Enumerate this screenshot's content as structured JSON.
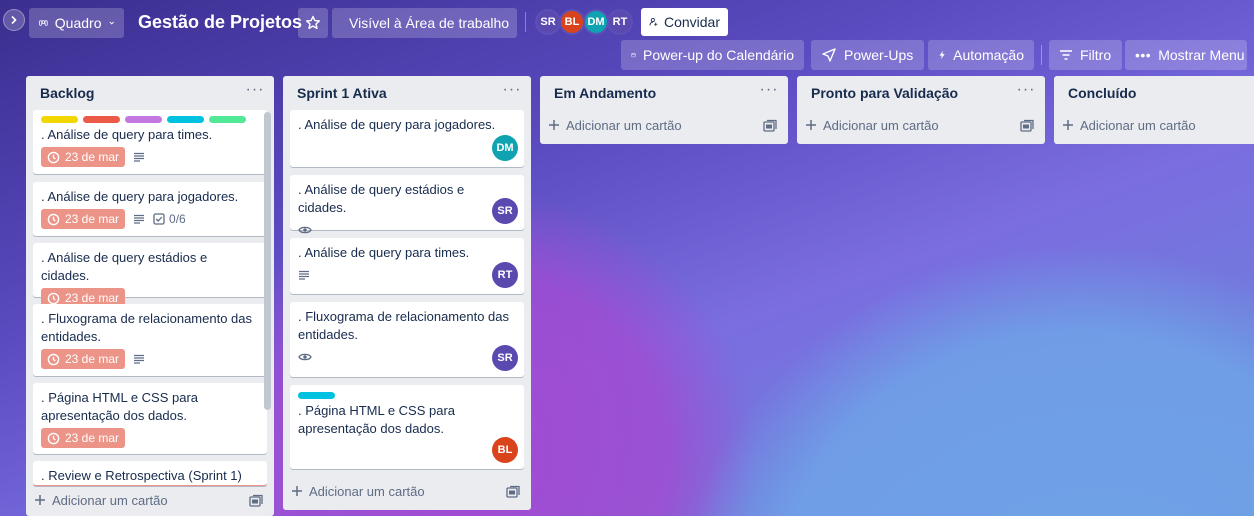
{
  "colors": {
    "due_badge": "#ec9488",
    "label_yellow": "#f2d600",
    "label_red": "#eb5a46",
    "label_purple": "#c377e0",
    "label_sky": "#00c2e0",
    "label_lime": "#51e898",
    "avatar_sr": "#5a4ab0",
    "avatar_bl": "#d9441c",
    "avatar_dm": "#0fa3b1",
    "avatar_rt": "#5a4ab0"
  },
  "header": {
    "view_label": "Quadro",
    "board_title": "Gestão de Projetos",
    "visibility_label": "Visível à Área de trabalho",
    "members": [
      "SR",
      "BL",
      "DM",
      "RT"
    ],
    "invite_label": "Convidar",
    "calendar_label": "Power-up do Calendário",
    "powerups_label": "Power-Ups",
    "automation_label": "Automação",
    "filter_label": "Filtro",
    "menu_label": "Mostrar Menu"
  },
  "lists": [
    {
      "title": "Backlog",
      "add_label": "Adicionar um cartão",
      "cards": [
        {
          "title": ". Análise de query para times.",
          "due": "23 de mar",
          "labels": [
            "label-yellow",
            "label-red",
            "label-purple",
            "label-sky",
            "label-lime"
          ]
        },
        {
          "title": ". Análise de query para jogadores.",
          "due": "23 de mar",
          "checklist": "0/6"
        },
        {
          "title": ". Análise de query estádios e cidades.",
          "due": "23 de mar"
        },
        {
          "title": ". Fluxograma de relacionamento das entidades.",
          "due": "23 de mar"
        },
        {
          "title": ". Página HTML e CSS para apresentação dos dados.",
          "due": "23 de mar"
        },
        {
          "title": ". Review e Retrospectiva (Sprint 1)"
        }
      ]
    },
    {
      "title": "Sprint 1 Ativa",
      "add_label": "Adicionar um cartão",
      "cards": [
        {
          "title": ". Análise de query para jogadores.",
          "member": "DM"
        },
        {
          "title": ". Análise de query estádios e cidades.",
          "member": "SR"
        },
        {
          "title": ". Análise de query para times.",
          "member": "RT"
        },
        {
          "title": ". Fluxograma de relacionamento das entidades.",
          "member": "SR"
        },
        {
          "title": ". Página HTML e CSS para apresentação dos dados.",
          "member": "BL",
          "labels": [
            "label-sky"
          ]
        }
      ]
    },
    {
      "title": "Em Andamento",
      "add_label": "Adicionar um cartão"
    },
    {
      "title": "Pronto para Validação",
      "add_label": "Adicionar um cartão"
    },
    {
      "title": "Concluído",
      "add_label": "Adicionar um cartão"
    }
  ]
}
